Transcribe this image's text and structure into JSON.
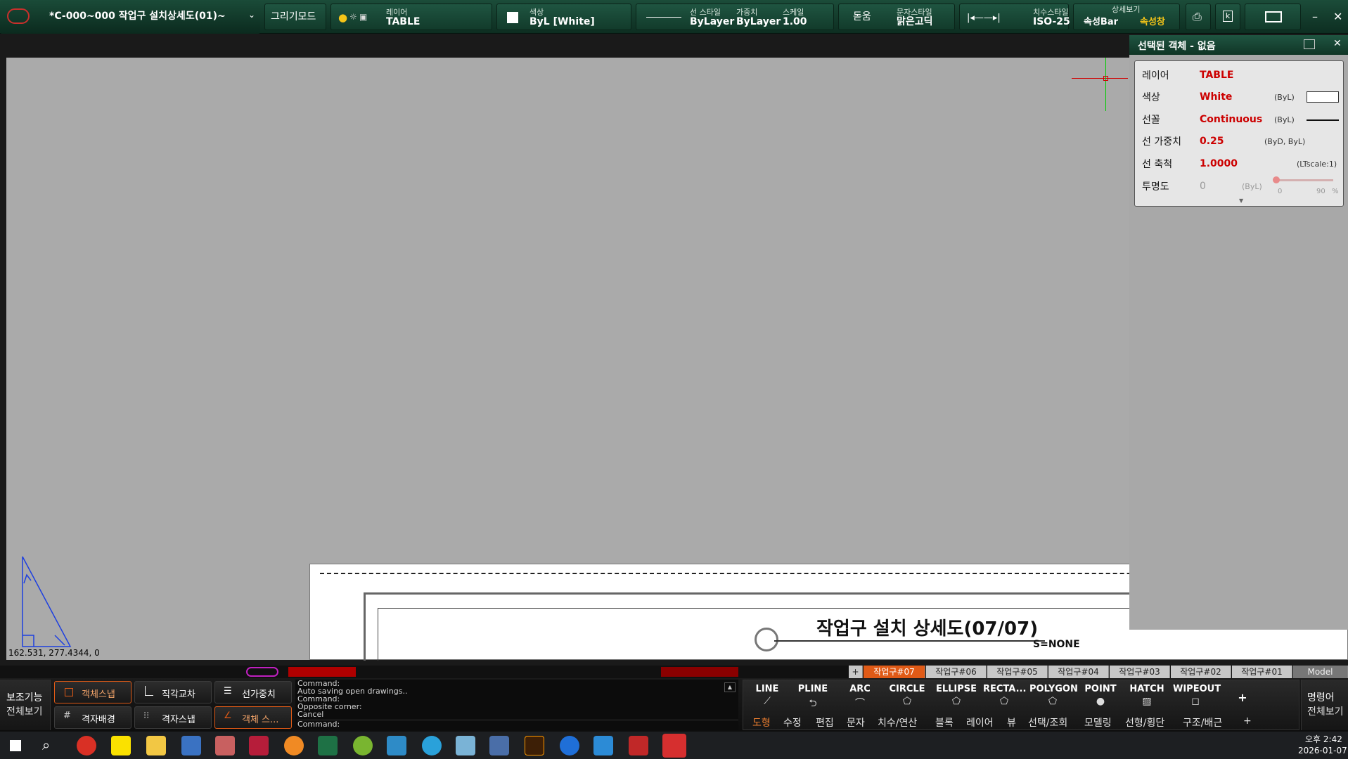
{
  "titlebar": {
    "doc_title": "*C-000~000 작업구 설치상세도(01)~",
    "mode": "그리기모드",
    "layer_label": "레이어",
    "layer_value": "TABLE",
    "color_label": "색상",
    "color_value": "ByL [White]",
    "linestyle_label": "선 스타일",
    "linestyle_value": "ByLayer",
    "weight_label": "가중치",
    "weight_value": "ByLayer",
    "scale_label": "스케일",
    "scale_value": "1.00",
    "font_button": "돋움",
    "textstyle_label": "문자스타일",
    "textstyle_value": "맑은고딕",
    "dimstyle_label": "치수스타일",
    "dimstyle_value": "ISO-25",
    "detail_label": "상세보기",
    "propbar": "속성Bar",
    "propwin": "속성창"
  },
  "canvas": {
    "coords": "162.531, 277.4344, 0",
    "drawing_title": "작업구 설치 상세도(07/07)",
    "drawing_scale": "S=NONE"
  },
  "properties": {
    "header": "선택된 객체 - 없음",
    "rows": [
      {
        "label": "레이어",
        "value": "TABLE",
        "note": ""
      },
      {
        "label": "색상",
        "value": "White",
        "note": "(ByL)"
      },
      {
        "label": "선꼴",
        "value": "Continuous",
        "note": "(ByL)"
      },
      {
        "label": "선 가중치",
        "value": "0.25",
        "note": "(ByD, ByL)"
      },
      {
        "label": "선 축척",
        "value": "1.0000",
        "note": "(LTscale:1)"
      },
      {
        "label": "투명도",
        "value": "0",
        "note": "(ByL)"
      }
    ],
    "transparency_min": "0",
    "transparency_max": "90",
    "transparency_unit": "%"
  },
  "layout_tabs": [
    "+",
    "작업구#07",
    "작업구#06",
    "작업구#05",
    "작업구#04",
    "작업구#03",
    "작업구#02",
    "작업구#01",
    "Model"
  ],
  "active_tab": "작업구#07",
  "left_panel": {
    "title": "보조기능",
    "sub": "전체보기",
    "buttons": [
      "객체스냅",
      "직각교차",
      "선가중치",
      "격자배경",
      "격자스냅",
      "객체 스..."
    ]
  },
  "command_log": [
    "Command:",
    "Auto saving open drawings..",
    "Command:",
    "Opposite corner:",
    "Cancel",
    "Command:"
  ],
  "draw_tools": [
    "LINE",
    "PLINE",
    "ARC",
    "CIRCLE",
    "ELLIPSE",
    "RECTA...",
    "POLYGON",
    "POINT",
    "HATCH",
    "WIPEOUT",
    "+"
  ],
  "bottom_tabs": [
    "도형",
    "수정",
    "편집",
    "문자",
    "치수/연산",
    "블록",
    "레이어",
    "뷰",
    "선택/조회",
    "모델링",
    "선형/횡단",
    "구조/배근",
    "+"
  ],
  "command_panel": {
    "title": "명령어",
    "sub": "전체보기"
  },
  "taskbar": {
    "time": "오후 2:42",
    "date": "2026-01-07"
  },
  "colors": {
    "accent": "#e05a16",
    "panel_green": "#1b4c39",
    "prop_red": "#cc0000"
  }
}
